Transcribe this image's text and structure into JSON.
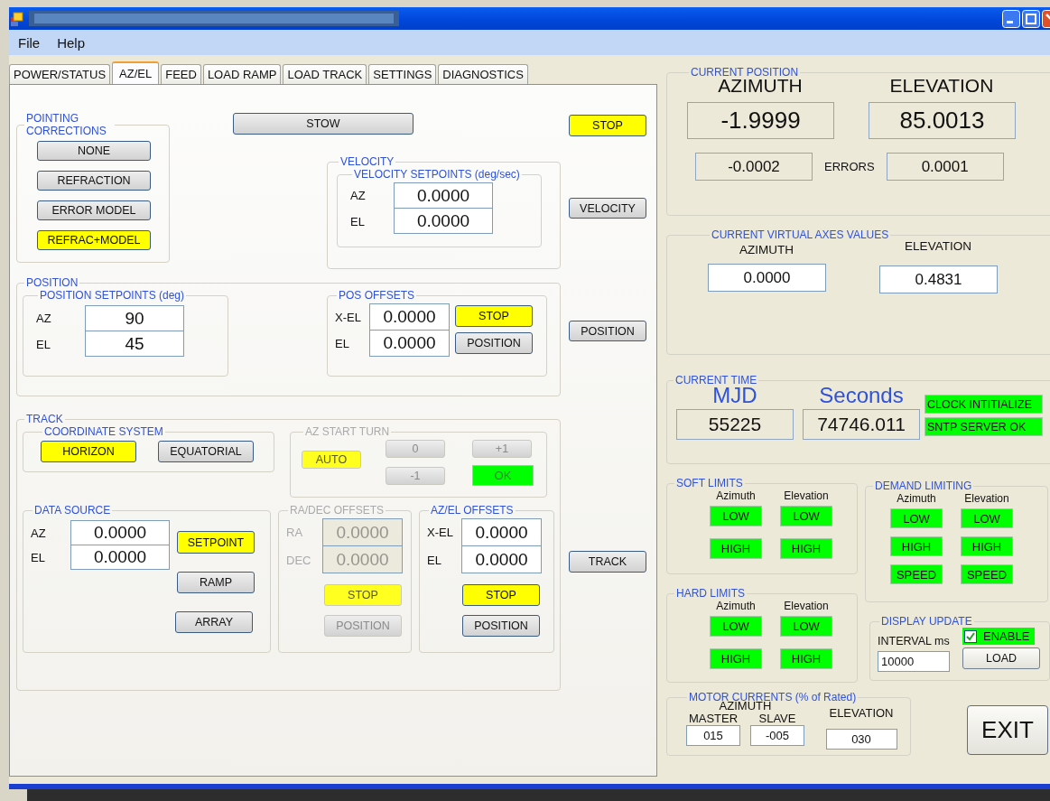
{
  "menu": [
    {
      "label": "File"
    },
    {
      "label": "Help"
    }
  ],
  "tabs": [
    {
      "label": "POWER/STATUS",
      "selected": false
    },
    {
      "label": "AZ/EL",
      "selected": true
    },
    {
      "label": "FEED",
      "selected": false
    },
    {
      "label": "LOAD RAMP",
      "selected": false
    },
    {
      "label": "LOAD TRACK",
      "selected": false
    },
    {
      "label": "SETTINGS",
      "selected": false
    },
    {
      "label": "DIAGNOSTICS",
      "selected": false
    }
  ],
  "tab_page": {
    "pointing_corrections": {
      "title": "POINTING CORRECTIONS",
      "buttons": [
        {
          "label": "NONE",
          "highlight": false
        },
        {
          "label": "REFRACTION",
          "highlight": false
        },
        {
          "label": "ERROR MODEL",
          "highlight": false
        },
        {
          "label": "REFRAC+MODEL",
          "highlight": true
        }
      ]
    },
    "stow_button": {
      "label": "STOW",
      "highlight": false
    },
    "stop_button": {
      "label": "STOP",
      "highlight": true
    },
    "velocity": {
      "title": "VELOCITY",
      "setpoints": {
        "title": "VELOCITY SETPOINTS (deg/sec)",
        "fields": [
          {
            "label": "AZ",
            "value": "0.0000"
          },
          {
            "label": "EL",
            "value": "0.0000"
          }
        ]
      }
    },
    "velocity_button": {
      "label": "VELOCITY",
      "highlight": false
    },
    "position": {
      "title": "POSITION",
      "setpoints": {
        "title": "POSITION SETPOINTS (deg)",
        "fields": [
          {
            "label": "AZ",
            "value": "90"
          },
          {
            "label": "EL",
            "value": "45"
          }
        ]
      },
      "offsets": {
        "title": "POS OFFSETS",
        "fields": [
          {
            "label": "X-EL",
            "value": "0.0000"
          },
          {
            "label": "EL",
            "value": "0.0000"
          }
        ],
        "buttons": [
          {
            "label": "STOP",
            "highlight": true
          },
          {
            "label": "POSITION",
            "highlight": false
          }
        ]
      }
    },
    "position_button": {
      "label": "POSITION",
      "highlight": false
    },
    "track": {
      "title": "TRACK",
      "coordinate_system": {
        "title": "COORDINATE SYSTEM",
        "buttons": [
          {
            "label": "HORIZON",
            "highlight": true
          },
          {
            "label": "EQUATORIAL",
            "highlight": false
          }
        ]
      },
      "az_start_turn": {
        "title": "AZ START TURN",
        "disabled": true,
        "buttons": [
          {
            "label": "AUTO",
            "highlight": true
          },
          {
            "label": "0",
            "highlight": false
          },
          {
            "label": "+1",
            "highlight": false
          },
          {
            "label": "-1",
            "highlight": false
          }
        ],
        "ok_lamp": {
          "label": "OK",
          "on": true
        }
      },
      "data_source": {
        "title": "DATA SOURCE",
        "disabled": false,
        "fields": [
          {
            "label": "AZ",
            "value": "0.0000"
          },
          {
            "label": "EL",
            "value": "0.0000"
          }
        ],
        "buttons": [
          {
            "label": "SETPOINT",
            "highlight": true
          },
          {
            "label": "RAMP",
            "highlight": false
          },
          {
            "label": "ARRAY",
            "highlight": false
          }
        ]
      },
      "ra_dec_offsets": {
        "title": "RA/DEC OFFSETS",
        "disabled": true,
        "fields": [
          {
            "label": "RA",
            "value": "0.0000"
          },
          {
            "label": "DEC",
            "value": "0.0000"
          }
        ],
        "buttons": [
          {
            "label": "STOP",
            "highlight": true
          },
          {
            "label": "POSITION",
            "highlight": false
          }
        ]
      },
      "az_el_offsets": {
        "title": "AZ/EL OFFSETS",
        "disabled": false,
        "fields": [
          {
            "label": "X-EL",
            "value": "0.0000"
          },
          {
            "label": "EL",
            "value": "0.0000"
          }
        ],
        "buttons": [
          {
            "label": "STOP",
            "highlight": true
          },
          {
            "label": "POSITION",
            "highlight": false
          }
        ]
      }
    },
    "track_button": {
      "label": "TRACK",
      "highlight": false
    }
  },
  "status_panel": {
    "current_position": {
      "title": "CURRENT POSITION",
      "columns": [
        {
          "heading": "AZIMUTH",
          "value": "-1.9999",
          "error": "-0.0002"
        },
        {
          "heading": "ELEVATION",
          "value": "85.0013",
          "error": "0.0001"
        }
      ],
      "errors_label": "ERRORS"
    },
    "virtual_axes": {
      "title": "CURRENT VIRTUAL AXES VALUES",
      "columns": [
        {
          "heading": "AZIMUTH",
          "value": "0.0000"
        },
        {
          "heading": "ELEVATION",
          "value": "0.4831"
        }
      ]
    },
    "current_time": {
      "title": "CURRENT TIME",
      "mjd": {
        "heading": "MJD",
        "value": "55225"
      },
      "seconds": {
        "heading": "Seconds",
        "value": "74746.011"
      },
      "indicators": [
        {
          "label": "CLOCK INTITIALIZE",
          "on": true
        },
        {
          "label": "SNTP SERVER OK",
          "on": true
        }
      ]
    },
    "soft_limits": {
      "title": "SOFT LIMITS",
      "columns": [
        {
          "heading": "Azimuth",
          "lamps": [
            {
              "label": "LOW",
              "on": true
            },
            {
              "label": "HIGH",
              "on": true
            }
          ]
        },
        {
          "heading": "Elevation",
          "lamps": [
            {
              "label": "LOW",
              "on": true
            },
            {
              "label": "HIGH",
              "on": true
            }
          ]
        }
      ]
    },
    "hard_limits": {
      "title": "HARD LIMITS",
      "columns": [
        {
          "heading": "Azimuth",
          "lamps": [
            {
              "label": "LOW",
              "on": true
            },
            {
              "label": "HIGH",
              "on": true
            }
          ]
        },
        {
          "heading": "Elevation",
          "lamps": [
            {
              "label": "LOW",
              "on": true
            },
            {
              "label": "HIGH",
              "on": true
            }
          ]
        }
      ]
    },
    "demand_limiting": {
      "title": "DEMAND LIMITING",
      "columns": [
        {
          "heading": "Azimuth",
          "lamps": [
            {
              "label": "LOW",
              "on": true
            },
            {
              "label": "HIGH",
              "on": true
            },
            {
              "label": "SPEED",
              "on": true
            }
          ]
        },
        {
          "heading": "Elevation",
          "lamps": [
            {
              "label": "LOW",
              "on": true
            },
            {
              "label": "HIGH",
              "on": true
            },
            {
              "label": "SPEED",
              "on": true
            }
          ]
        }
      ]
    },
    "display_update": {
      "title": "DISPLAY UPDATE",
      "interval_label": "INTERVAL ms",
      "interval": "10000",
      "enable": {
        "label": "ENABLE",
        "checked": true
      },
      "load_button": {
        "label": "LOAD"
      }
    },
    "motor_currents": {
      "title": "MOTOR CURRENTS (% of Rated)",
      "azimuth_heading": "AZIMUTH",
      "fields": [
        {
          "label": "MASTER",
          "value": "015"
        },
        {
          "label": "SLAVE",
          "value": "-005"
        },
        {
          "label": "ELEVATION",
          "value": "030"
        }
      ]
    },
    "exit_button": {
      "label": "EXIT"
    }
  }
}
